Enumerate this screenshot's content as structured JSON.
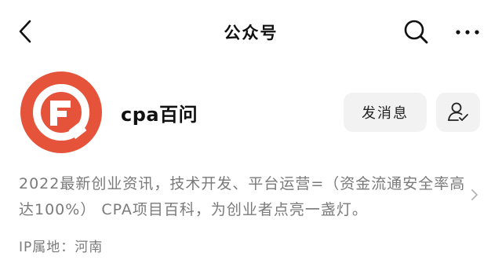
{
  "header": {
    "title": "公众号",
    "back_icon": "chevron-left-icon",
    "search_icon": "search-icon",
    "more_icon": "more-horizontal-icon"
  },
  "account": {
    "name": "cpa百问",
    "avatar_icon": "orange-circle-logo",
    "brand_color": "#e5533a",
    "message_button_label": "发消息",
    "follow_icon": "user-check-icon"
  },
  "profile": {
    "intro": "2022最新创业资讯，技术开发、平台运营=（资金流通安全率高达100%） CPA项目百科，为创业者点亮一盏灯。",
    "ip_location": "IP属地：河南"
  }
}
